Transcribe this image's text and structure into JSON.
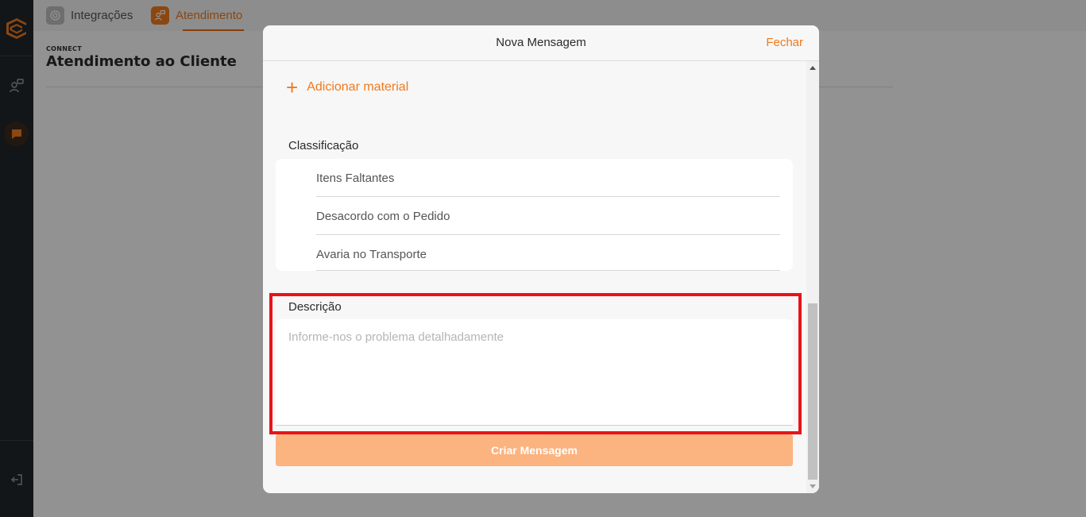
{
  "topbar": {
    "tabs": [
      {
        "label": "Integrações",
        "icon": "integrations-icon"
      },
      {
        "label": "Atendimento",
        "icon": "support-icon",
        "active": true
      }
    ]
  },
  "page": {
    "kicker": "CONNECT",
    "title": "Atendimento ao Cliente"
  },
  "sidebar": {
    "icons": [
      "logo-icon",
      "support-icon",
      "chat-icon",
      "logout-icon"
    ]
  },
  "modal": {
    "title": "Nova Mensagem",
    "close_label": "Fechar",
    "add_material_label": "Adicionar material",
    "classification_label": "Classificação",
    "classification_options": [
      "Itens Faltantes",
      "Desacordo com o Pedido",
      "Avaria no Transporte"
    ],
    "description_label": "Descrição",
    "description_placeholder": "Informe-nos o problema detalhadamente",
    "description_value": "",
    "create_button_label": "Criar Mensagem"
  },
  "colors": {
    "accent": "#f07a1e",
    "button_disabled": "#fbb37f",
    "highlight": "#e8141a",
    "sidebar_bg": "#22262b"
  }
}
